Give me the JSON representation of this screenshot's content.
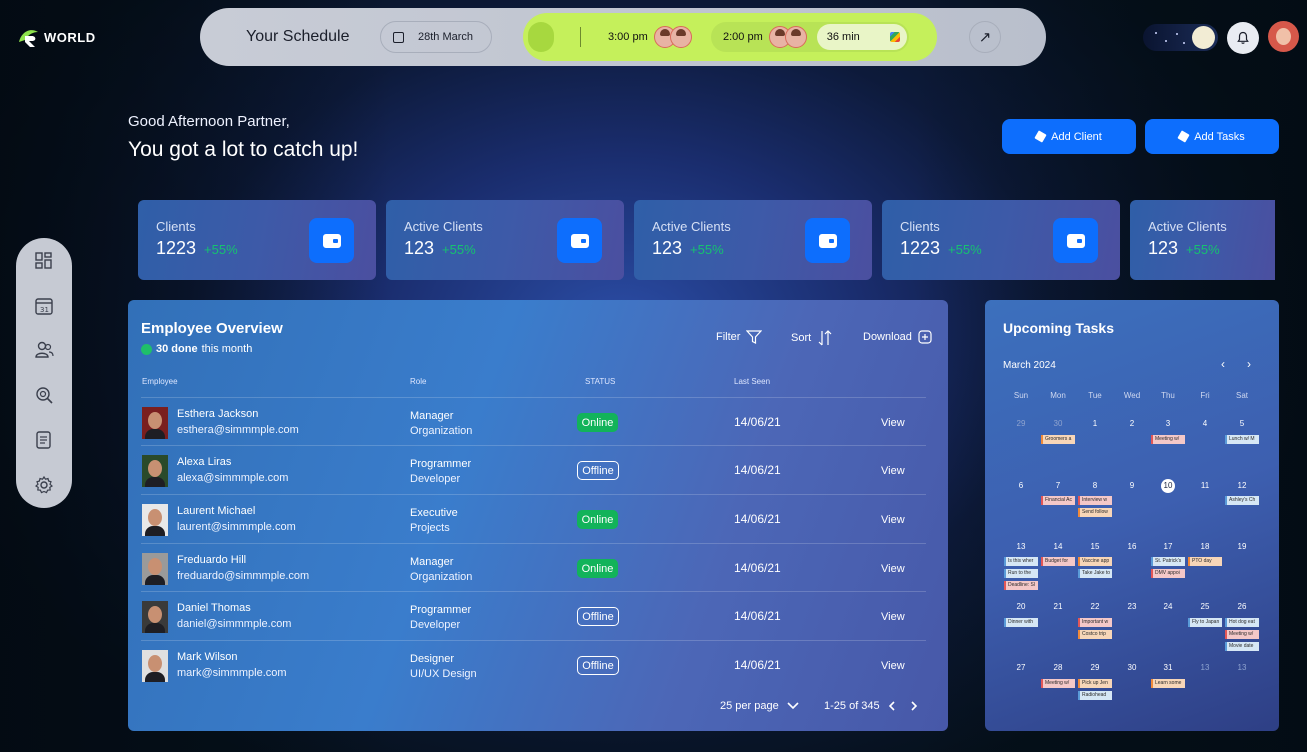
{
  "brand": {
    "name": "WORLD"
  },
  "schedule": {
    "title": "Your Schedule",
    "date": "28th March",
    "slot1_time": "3:00 pm",
    "slot2_time": "2:00 pm",
    "duration": "36 min"
  },
  "greeting": {
    "line1": "Good Afternoon Partner,",
    "line2": "You got a lot to catch up!"
  },
  "actions": {
    "add_client": "Add Client",
    "add_tasks": "Add Tasks"
  },
  "stats": [
    {
      "label": "Clients",
      "value": "1223",
      "change": "+55%"
    },
    {
      "label": "Active Clients",
      "value": "123",
      "change": "+55%"
    },
    {
      "label": "Active Clients",
      "value": "123",
      "change": "+55%"
    },
    {
      "label": "Clients",
      "value": "1223",
      "change": "+55%"
    },
    {
      "label": "Active Clients",
      "value": "123",
      "change": "+55%"
    }
  ],
  "employees": {
    "title": "Employee Overview",
    "done_count": "30 done",
    "done_suffix": "this month",
    "filter": "Filter",
    "sort": "Sort",
    "download": "Download",
    "columns": {
      "employee": "Employee",
      "role": "Role",
      "status": "STATUS",
      "last_seen": "Last Seen"
    },
    "rows": [
      {
        "name": "Esthera Jackson",
        "email": "esthera@simmmple.com",
        "role": "Manager",
        "dept": "Organization",
        "status": "Online",
        "last_seen": "14/06/21",
        "action": "View"
      },
      {
        "name": "Alexa Liras",
        "email": "alexa@simmmple.com",
        "role": "Programmer",
        "dept": "Developer",
        "status": "Offline",
        "last_seen": "14/06/21",
        "action": "View"
      },
      {
        "name": "Laurent Michael",
        "email": "laurent@simmmple.com",
        "role": "Executive",
        "dept": "Projects",
        "status": "Online",
        "last_seen": "14/06/21",
        "action": "View"
      },
      {
        "name": "Freduardo Hill",
        "email": "freduardo@simmmple.com",
        "role": "Manager",
        "dept": "Organization",
        "status": "Online",
        "last_seen": "14/06/21",
        "action": "View"
      },
      {
        "name": "Daniel Thomas",
        "email": "daniel@simmmple.com",
        "role": "Programmer",
        "dept": "Developer",
        "status": "Offline",
        "last_seen": "14/06/21",
        "action": "View"
      },
      {
        "name": "Mark Wilson",
        "email": "mark@simmmple.com",
        "role": "Designer",
        "dept": "UI/UX Design",
        "status": "Offline",
        "last_seen": "14/06/21",
        "action": "View"
      }
    ],
    "per_page": "25 per page",
    "range": "1-25 of 345"
  },
  "tasks": {
    "title": "Upcoming Tasks",
    "month": "March 2024",
    "weekdays": [
      "Sun",
      "Mon",
      "Tue",
      "Wed",
      "Thu",
      "Fri",
      "Sat"
    ],
    "weeks": [
      [
        "29",
        "30",
        "1",
        "2",
        "3",
        "4",
        "5"
      ],
      [
        "6",
        "7",
        "8",
        "9",
        "10",
        "11",
        "12"
      ],
      [
        "13",
        "14",
        "15",
        "16",
        "17",
        "18",
        "19"
      ],
      [
        "20",
        "21",
        "22",
        "23",
        "24",
        "25",
        "26"
      ],
      [
        "27",
        "28",
        "29",
        "30",
        "31",
        "13",
        "13"
      ]
    ],
    "events": {
      "groomers": "Groomers a",
      "meeting1": "Meeting w/",
      "lunch": "Lunch w/ M",
      "financial": "Financial Ac",
      "interview": "Interview w",
      "ashley": "Ashley's Ch",
      "send_follow": "Send follow",
      "is_this": "Is this wher",
      "budget": "Budget for",
      "vaccine": "Vaccine app",
      "st_patricks": "St. Patrick's",
      "pto": "PTO day",
      "run_to": "Run to the",
      "take_jake": "Take Jake to",
      "dmv": "DMV appoi",
      "deadline": "Deadline: Sl",
      "dinner": "Dinner with",
      "important": "Important w",
      "fly": "Fly to Japan",
      "hotdog": "Hot dog eat",
      "costco": "Costco trip",
      "meeting2": "Meeting w/",
      "movie": "Movie date",
      "meeting3": "Meeting w/",
      "pickup": "Pick up Jen",
      "learn": "Learn some",
      "radiohead": "Radiohead"
    }
  }
}
